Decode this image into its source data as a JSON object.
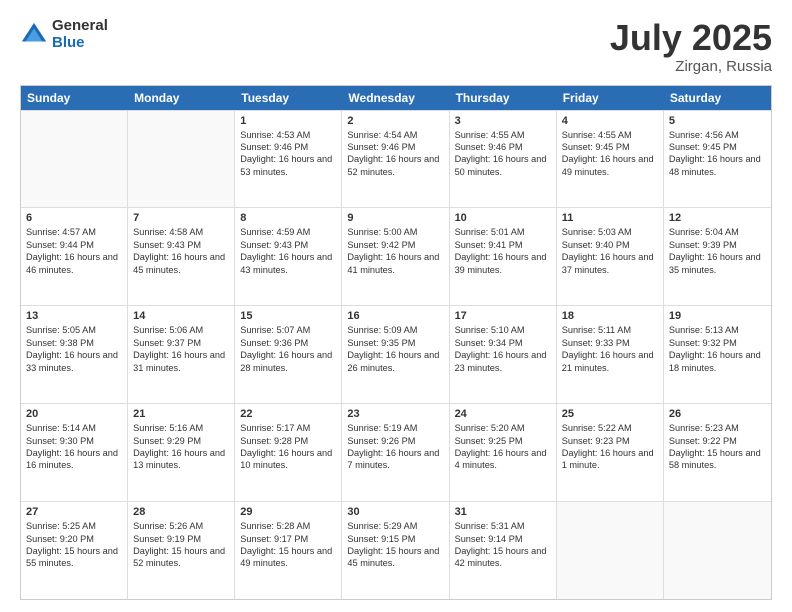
{
  "logo": {
    "general": "General",
    "blue": "Blue"
  },
  "title": {
    "month": "July 2025",
    "location": "Zirgan, Russia"
  },
  "header": {
    "days": [
      "Sunday",
      "Monday",
      "Tuesday",
      "Wednesday",
      "Thursday",
      "Friday",
      "Saturday"
    ]
  },
  "weeks": [
    [
      {
        "day": "",
        "empty": true
      },
      {
        "day": "",
        "empty": true
      },
      {
        "day": "1",
        "sunrise": "Sunrise: 4:53 AM",
        "sunset": "Sunset: 9:46 PM",
        "daylight": "Daylight: 16 hours and 53 minutes."
      },
      {
        "day": "2",
        "sunrise": "Sunrise: 4:54 AM",
        "sunset": "Sunset: 9:46 PM",
        "daylight": "Daylight: 16 hours and 52 minutes."
      },
      {
        "day": "3",
        "sunrise": "Sunrise: 4:55 AM",
        "sunset": "Sunset: 9:46 PM",
        "daylight": "Daylight: 16 hours and 50 minutes."
      },
      {
        "day": "4",
        "sunrise": "Sunrise: 4:55 AM",
        "sunset": "Sunset: 9:45 PM",
        "daylight": "Daylight: 16 hours and 49 minutes."
      },
      {
        "day": "5",
        "sunrise": "Sunrise: 4:56 AM",
        "sunset": "Sunset: 9:45 PM",
        "daylight": "Daylight: 16 hours and 48 minutes."
      }
    ],
    [
      {
        "day": "6",
        "sunrise": "Sunrise: 4:57 AM",
        "sunset": "Sunset: 9:44 PM",
        "daylight": "Daylight: 16 hours and 46 minutes."
      },
      {
        "day": "7",
        "sunrise": "Sunrise: 4:58 AM",
        "sunset": "Sunset: 9:43 PM",
        "daylight": "Daylight: 16 hours and 45 minutes."
      },
      {
        "day": "8",
        "sunrise": "Sunrise: 4:59 AM",
        "sunset": "Sunset: 9:43 PM",
        "daylight": "Daylight: 16 hours and 43 minutes."
      },
      {
        "day": "9",
        "sunrise": "Sunrise: 5:00 AM",
        "sunset": "Sunset: 9:42 PM",
        "daylight": "Daylight: 16 hours and 41 minutes."
      },
      {
        "day": "10",
        "sunrise": "Sunrise: 5:01 AM",
        "sunset": "Sunset: 9:41 PM",
        "daylight": "Daylight: 16 hours and 39 minutes."
      },
      {
        "day": "11",
        "sunrise": "Sunrise: 5:03 AM",
        "sunset": "Sunset: 9:40 PM",
        "daylight": "Daylight: 16 hours and 37 minutes."
      },
      {
        "day": "12",
        "sunrise": "Sunrise: 5:04 AM",
        "sunset": "Sunset: 9:39 PM",
        "daylight": "Daylight: 16 hours and 35 minutes."
      }
    ],
    [
      {
        "day": "13",
        "sunrise": "Sunrise: 5:05 AM",
        "sunset": "Sunset: 9:38 PM",
        "daylight": "Daylight: 16 hours and 33 minutes."
      },
      {
        "day": "14",
        "sunrise": "Sunrise: 5:06 AM",
        "sunset": "Sunset: 9:37 PM",
        "daylight": "Daylight: 16 hours and 31 minutes."
      },
      {
        "day": "15",
        "sunrise": "Sunrise: 5:07 AM",
        "sunset": "Sunset: 9:36 PM",
        "daylight": "Daylight: 16 hours and 28 minutes."
      },
      {
        "day": "16",
        "sunrise": "Sunrise: 5:09 AM",
        "sunset": "Sunset: 9:35 PM",
        "daylight": "Daylight: 16 hours and 26 minutes."
      },
      {
        "day": "17",
        "sunrise": "Sunrise: 5:10 AM",
        "sunset": "Sunset: 9:34 PM",
        "daylight": "Daylight: 16 hours and 23 minutes."
      },
      {
        "day": "18",
        "sunrise": "Sunrise: 5:11 AM",
        "sunset": "Sunset: 9:33 PM",
        "daylight": "Daylight: 16 hours and 21 minutes."
      },
      {
        "day": "19",
        "sunrise": "Sunrise: 5:13 AM",
        "sunset": "Sunset: 9:32 PM",
        "daylight": "Daylight: 16 hours and 18 minutes."
      }
    ],
    [
      {
        "day": "20",
        "sunrise": "Sunrise: 5:14 AM",
        "sunset": "Sunset: 9:30 PM",
        "daylight": "Daylight: 16 hours and 16 minutes."
      },
      {
        "day": "21",
        "sunrise": "Sunrise: 5:16 AM",
        "sunset": "Sunset: 9:29 PM",
        "daylight": "Daylight: 16 hours and 13 minutes."
      },
      {
        "day": "22",
        "sunrise": "Sunrise: 5:17 AM",
        "sunset": "Sunset: 9:28 PM",
        "daylight": "Daylight: 16 hours and 10 minutes."
      },
      {
        "day": "23",
        "sunrise": "Sunrise: 5:19 AM",
        "sunset": "Sunset: 9:26 PM",
        "daylight": "Daylight: 16 hours and 7 minutes."
      },
      {
        "day": "24",
        "sunrise": "Sunrise: 5:20 AM",
        "sunset": "Sunset: 9:25 PM",
        "daylight": "Daylight: 16 hours and 4 minutes."
      },
      {
        "day": "25",
        "sunrise": "Sunrise: 5:22 AM",
        "sunset": "Sunset: 9:23 PM",
        "daylight": "Daylight: 16 hours and 1 minute."
      },
      {
        "day": "26",
        "sunrise": "Sunrise: 5:23 AM",
        "sunset": "Sunset: 9:22 PM",
        "daylight": "Daylight: 15 hours and 58 minutes."
      }
    ],
    [
      {
        "day": "27",
        "sunrise": "Sunrise: 5:25 AM",
        "sunset": "Sunset: 9:20 PM",
        "daylight": "Daylight: 15 hours and 55 minutes."
      },
      {
        "day": "28",
        "sunrise": "Sunrise: 5:26 AM",
        "sunset": "Sunset: 9:19 PM",
        "daylight": "Daylight: 15 hours and 52 minutes."
      },
      {
        "day": "29",
        "sunrise": "Sunrise: 5:28 AM",
        "sunset": "Sunset: 9:17 PM",
        "daylight": "Daylight: 15 hours and 49 minutes."
      },
      {
        "day": "30",
        "sunrise": "Sunrise: 5:29 AM",
        "sunset": "Sunset: 9:15 PM",
        "daylight": "Daylight: 15 hours and 45 minutes."
      },
      {
        "day": "31",
        "sunrise": "Sunrise: 5:31 AM",
        "sunset": "Sunset: 9:14 PM",
        "daylight": "Daylight: 15 hours and 42 minutes."
      },
      {
        "day": "",
        "empty": true
      },
      {
        "day": "",
        "empty": true
      }
    ]
  ]
}
